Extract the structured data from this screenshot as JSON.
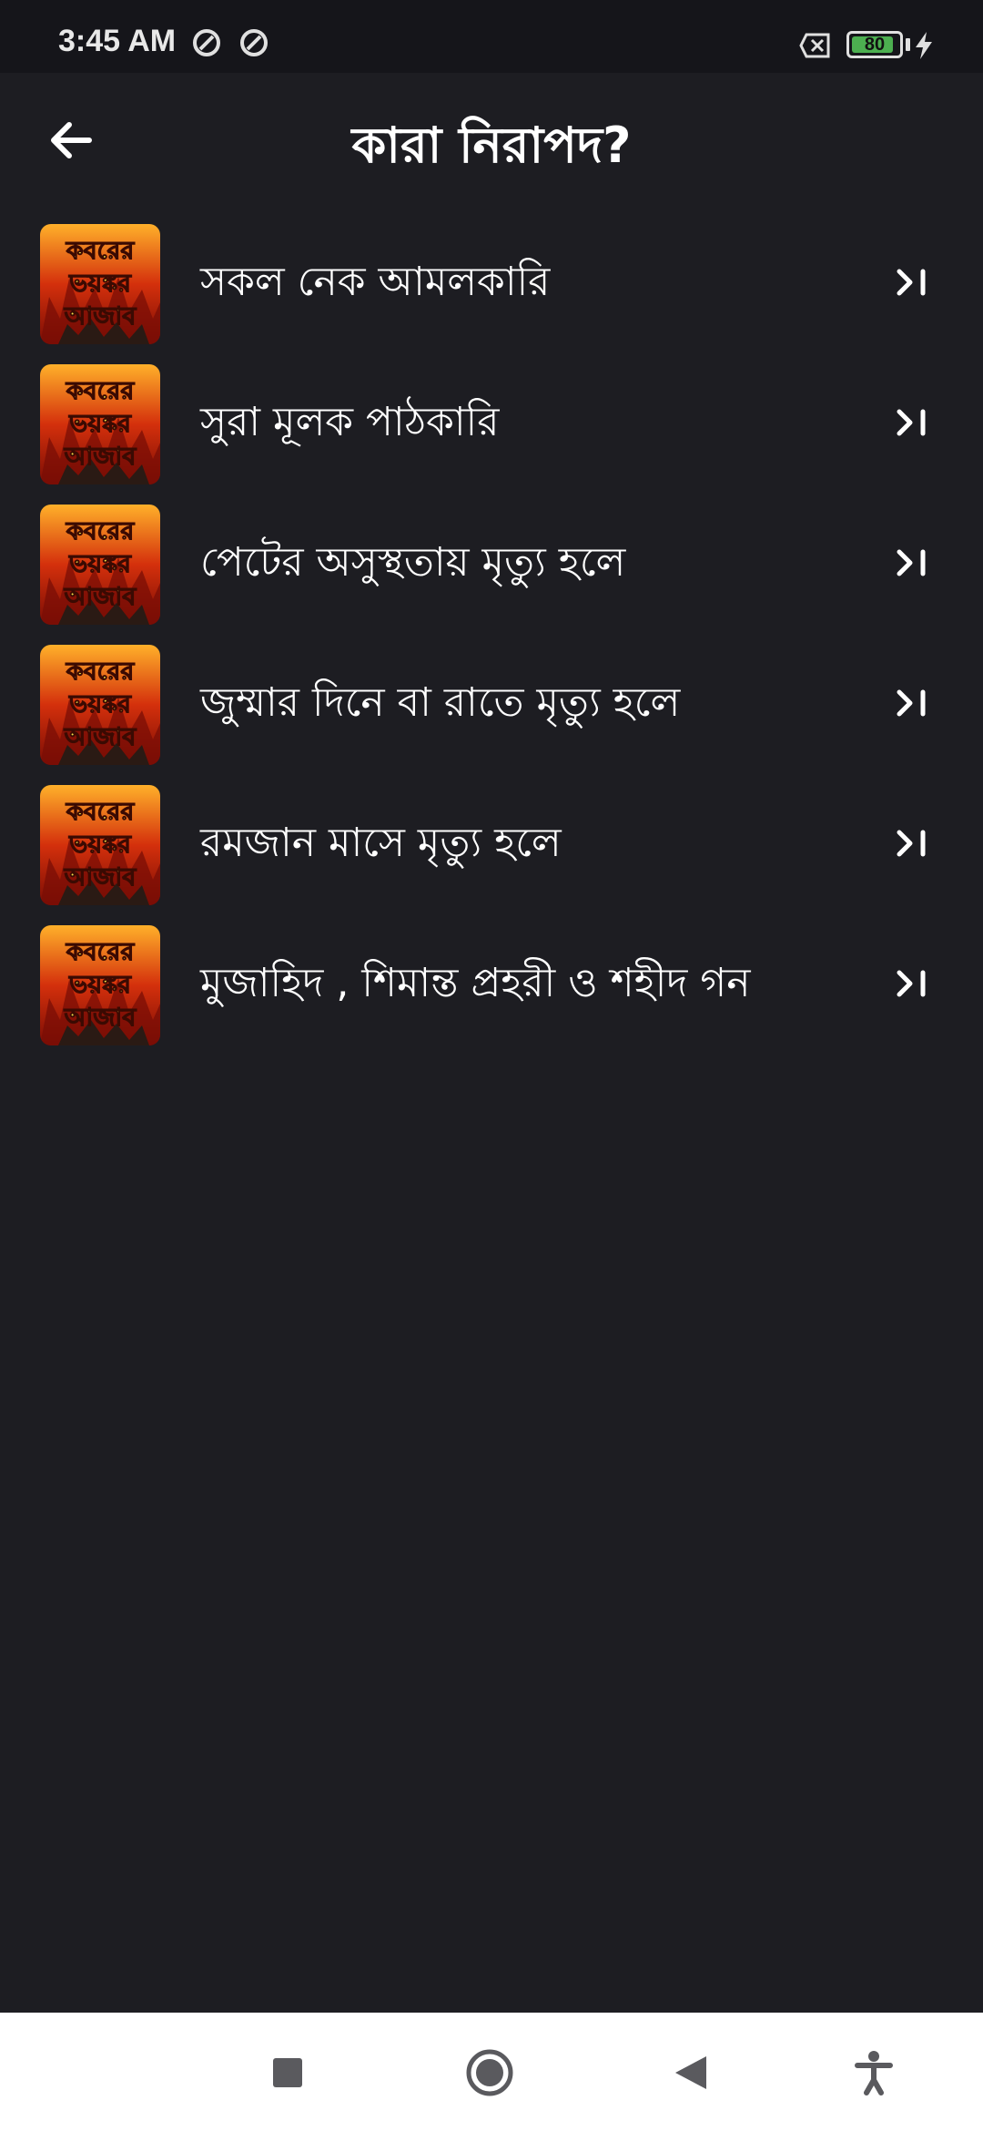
{
  "status_bar": {
    "time": "3:45 AM",
    "battery_level": "80",
    "icons": [
      "sync-icon",
      "sync-icon",
      "no-sim-icon",
      "battery-icon",
      "charging-icon"
    ]
  },
  "header": {
    "title": "কারা নিরাপদ?",
    "back_icon": "arrow-left-icon"
  },
  "list": {
    "items": [
      {
        "label": "সকল নেক আমলকারি"
      },
      {
        "label": "সুরা মূলক পাঠকারি"
      },
      {
        "label": "পেটের অসুস্থতায় মৃত্যু হলে"
      },
      {
        "label": "জুম্মার দিনে বা রাতে মৃত্যু হলে"
      },
      {
        "label": "রমজান মাসে মৃত্যু হলে"
      },
      {
        "label": "মুজাহিদ , শিমান্ত প্রহরী ও শহীদ গন"
      }
    ],
    "thumbnail_text": [
      "কবরের",
      "ভয়ঙ্কর",
      "আজাব"
    ],
    "thumbnail_colors": {
      "fire_dark": "#7a0d05",
      "fire_mid": "#d4300c",
      "fire_light": "#ffb02a",
      "text": "#f2e64c"
    }
  },
  "nav_bar": {
    "buttons": [
      "recents-square-icon",
      "home-circle-icon",
      "back-triangle-icon",
      "accessibility-icon"
    ]
  },
  "colors": {
    "background": "#1d1d22",
    "status_bar": "#15151a",
    "nav_bar": "#ffffff"
  }
}
